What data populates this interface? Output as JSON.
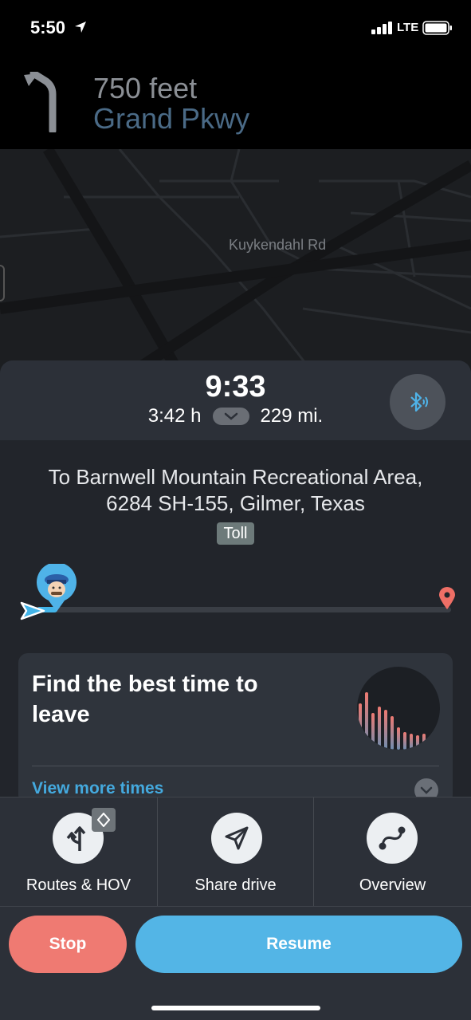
{
  "status_bar": {
    "time": "5:50",
    "network": "LTE",
    "icons": [
      "location-arrow-icon",
      "signal-bars-icon",
      "battery-icon"
    ]
  },
  "navigation": {
    "distance": "750 feet",
    "street": "Grand Pkwy",
    "turn_icon": "turn-slight-left-icon"
  },
  "map": {
    "road_label": "Kuykendahl Rd"
  },
  "trip": {
    "eta": "9:33",
    "duration": "3:42 h",
    "distance": "229 mi.",
    "destination_line1": "To Barnwell Mountain Recreational Area,",
    "destination_line2": "6284 SH-155, Gilmer, Texas",
    "toll_label": "Toll",
    "progress_fraction": 0.05,
    "bluetooth_icon": "bluetooth-audio-icon"
  },
  "best_time_card": {
    "title": "Find the best time to leave",
    "link": "View more times",
    "chart_icon": "departure-times-chart-icon"
  },
  "actions": [
    {
      "label": "Routes & HOV",
      "icon": "routes-split-icon",
      "badge_icon": "hov-diamond-icon"
    },
    {
      "label": "Share drive",
      "icon": "paper-plane-icon"
    },
    {
      "label": "Overview",
      "icon": "route-overview-icon"
    }
  ],
  "buttons": {
    "stop": "Stop",
    "resume": "Resume"
  },
  "colors": {
    "accent_blue": "#53b5e6",
    "stop_red": "#ef7a72",
    "panel_bg": "#22252b",
    "street_blue": "#4a6a86"
  }
}
